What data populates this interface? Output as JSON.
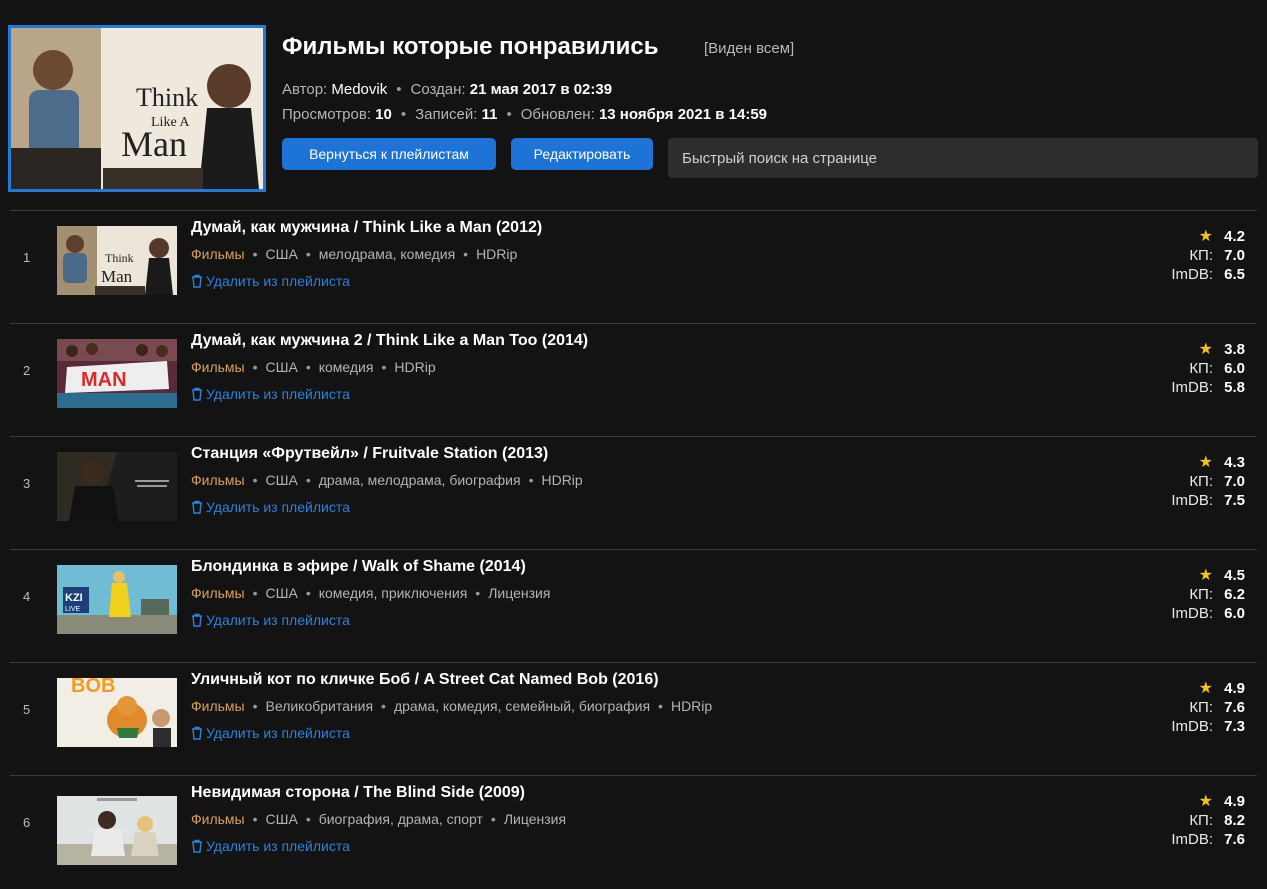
{
  "playlist": {
    "title": "Фильмы которые понравились",
    "visibility": "[Виден всем]",
    "author_label": "Автор:",
    "author": "Medovik",
    "created_label": "Создан:",
    "created": "21 мая 2017 в 02:39",
    "views_label": "Просмотров:",
    "views": "10",
    "entries_label": "Записей:",
    "entries": "11",
    "updated_label": "Обновлен:",
    "updated": "13 ноября 2021 в 14:59",
    "back_button": "Вернуться к плейлистам",
    "edit_button": "Редактировать",
    "search_placeholder": "Быстрый поиск на странице"
  },
  "labels": {
    "delete": "Удалить из плейлиста",
    "kp": "КП:",
    "imdb": "ImDB:",
    "star": "★"
  },
  "movies": [
    {
      "num": "1",
      "title": "Думай, как мужчина / Think Like a Man (2012)",
      "category": "Фильмы",
      "country": "США",
      "genres": "мелодрама, комедия",
      "quality": "HDRip",
      "rating": "4.2",
      "kp": "7.0",
      "imdb": "6.5"
    },
    {
      "num": "2",
      "title": "Думай, как мужчина 2 / Think Like a Man Too (2014)",
      "category": "Фильмы",
      "country": "США",
      "genres": "комедия",
      "quality": "HDRip",
      "rating": "3.8",
      "kp": "6.0",
      "imdb": "5.8"
    },
    {
      "num": "3",
      "title": "Станция «Фрутвейл» / Fruitvale Station (2013)",
      "category": "Фильмы",
      "country": "США",
      "genres": "драма, мелодрама, биография",
      "quality": "HDRip",
      "rating": "4.3",
      "kp": "7.0",
      "imdb": "7.5"
    },
    {
      "num": "4",
      "title": "Блондинка в эфире / Walk of Shame (2014)",
      "category": "Фильмы",
      "country": "США",
      "genres": "комедия, приключения",
      "quality": "Лицензия",
      "rating": "4.5",
      "kp": "6.2",
      "imdb": "6.0"
    },
    {
      "num": "5",
      "title": "Уличный кот по кличке Боб / A Street Cat Named Bob (2016)",
      "category": "Фильмы",
      "country": "Великобритания",
      "genres": "драма, комедия, семейный, биография",
      "quality": "HDRip",
      "rating": "4.9",
      "kp": "7.6",
      "imdb": "7.3"
    },
    {
      "num": "6",
      "title": "Невидимая сторона / The Blind Side (2009)",
      "category": "Фильмы",
      "country": "США",
      "genres": "биография, драма, спорт",
      "quality": "Лицензия",
      "rating": "4.9",
      "kp": "8.2",
      "imdb": "7.6"
    }
  ],
  "colors": {
    "background": "#131313",
    "accent": "#1e74d6",
    "category": "#d9a05b",
    "star": "#f4c21b",
    "link": "#2a82dc"
  }
}
